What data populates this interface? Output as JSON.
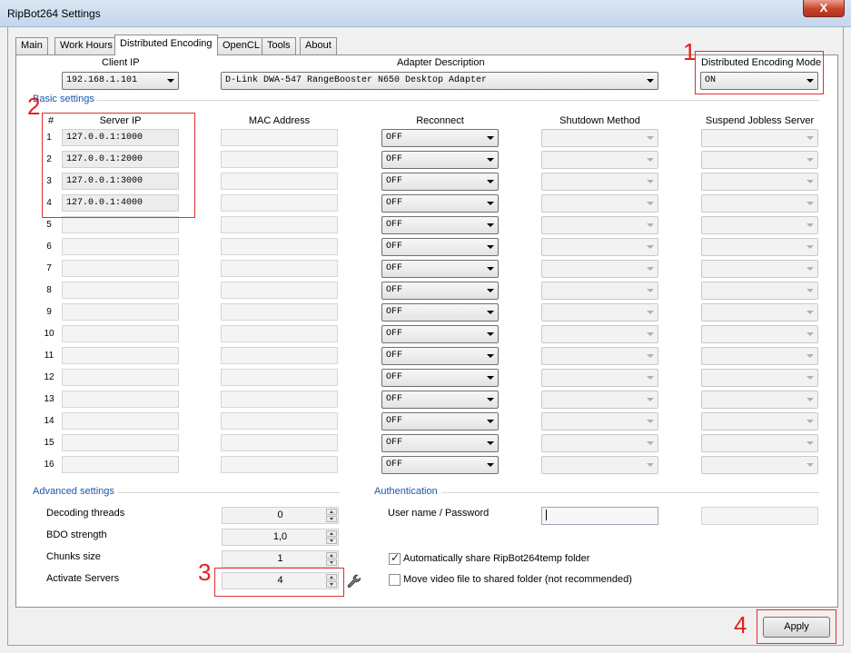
{
  "window": {
    "title": "RipBot264 Settings",
    "close_glyph": "X"
  },
  "tabs": [
    "Main",
    "Work Hours",
    "Distributed Encoding",
    "OpenCL",
    "Tools",
    "About"
  ],
  "active_tab": "Distributed Encoding",
  "client_ip": {
    "label": "Client IP",
    "value": "192.168.1.101"
  },
  "adapter": {
    "label": "Adapter Description",
    "value": "D-Link DWA-547 RangeBooster N650 Desktop Adapter"
  },
  "encoding_mode": {
    "label": "Distributed Encoding Mode",
    "value": "ON"
  },
  "basic_settings": {
    "title": "Basic settings",
    "columns": {
      "num": "#",
      "server_ip": "Server IP",
      "mac": "MAC Address",
      "reconnect": "Reconnect",
      "shutdown": "Shutdown Method",
      "suspend": "Suspend Jobless Server"
    },
    "rows": [
      {
        "n": "1",
        "server_ip": "127.0.0.1:1000",
        "reconnect": "OFF"
      },
      {
        "n": "2",
        "server_ip": "127.0.0.1:2000",
        "reconnect": "OFF"
      },
      {
        "n": "3",
        "server_ip": "127.0.0.1:3000",
        "reconnect": "OFF"
      },
      {
        "n": "4",
        "server_ip": "127.0.0.1:4000",
        "reconnect": "OFF"
      },
      {
        "n": "5",
        "server_ip": "",
        "reconnect": "OFF"
      },
      {
        "n": "6",
        "server_ip": "",
        "reconnect": "OFF"
      },
      {
        "n": "7",
        "server_ip": "",
        "reconnect": "OFF"
      },
      {
        "n": "8",
        "server_ip": "",
        "reconnect": "OFF"
      },
      {
        "n": "9",
        "server_ip": "",
        "reconnect": "OFF"
      },
      {
        "n": "10",
        "server_ip": "",
        "reconnect": "OFF"
      },
      {
        "n": "11",
        "server_ip": "",
        "reconnect": "OFF"
      },
      {
        "n": "12",
        "server_ip": "",
        "reconnect": "OFF"
      },
      {
        "n": "13",
        "server_ip": "",
        "reconnect": "OFF"
      },
      {
        "n": "14",
        "server_ip": "",
        "reconnect": "OFF"
      },
      {
        "n": "15",
        "server_ip": "",
        "reconnect": "OFF"
      },
      {
        "n": "16",
        "server_ip": "",
        "reconnect": "OFF"
      }
    ]
  },
  "advanced": {
    "title": "Advanced settings",
    "decoding_threads": {
      "label": "Decoding threads",
      "value": "0"
    },
    "bdo_strength": {
      "label": "BDO strength",
      "value": "1,0"
    },
    "chunks_size": {
      "label": "Chunks size",
      "value": "1"
    },
    "activate_servers": {
      "label": "Activate Servers",
      "value": "4"
    }
  },
  "auth": {
    "title": "Authentication",
    "user_label": "User name / Password",
    "user_value": "",
    "password_value": ""
  },
  "options": {
    "auto_share": {
      "label": "Automatically share RipBot264temp folder",
      "checked": true
    },
    "move_video": {
      "label": "Move video file to shared folder (not recommended)",
      "checked": false
    }
  },
  "apply_label": "Apply",
  "annotations": [
    "1",
    "2",
    "3",
    "4"
  ],
  "colors": {
    "annotation": "#e02020",
    "section_title": "#1c56a8"
  }
}
